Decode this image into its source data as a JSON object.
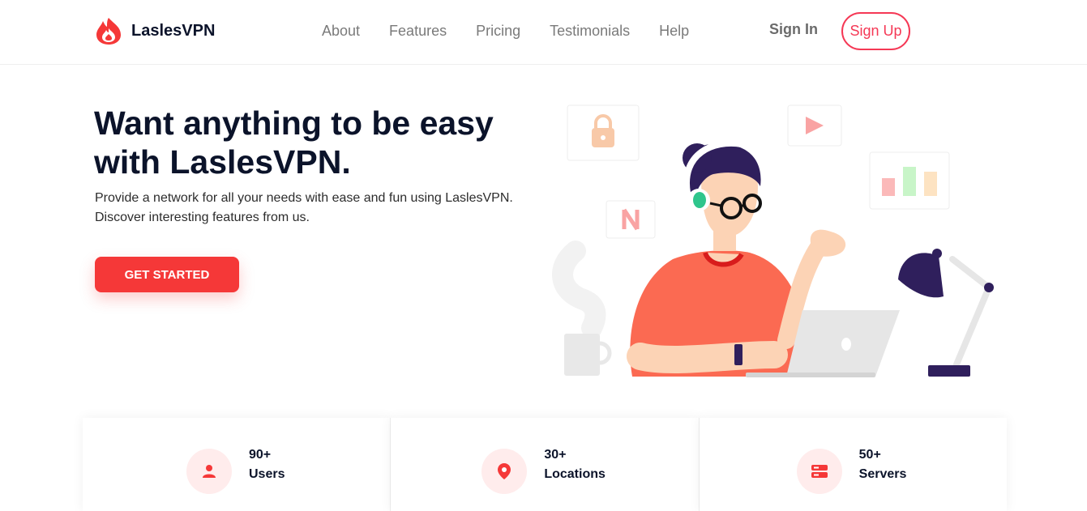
{
  "brand": {
    "name": "LaslesVPN",
    "accent": "#f53838"
  },
  "nav": {
    "items": [
      {
        "label": "About"
      },
      {
        "label": "Features"
      },
      {
        "label": "Pricing"
      },
      {
        "label": "Testimonials"
      },
      {
        "label": "Help"
      }
    ],
    "sign_in": "Sign In",
    "sign_up": "Sign Up"
  },
  "hero": {
    "title_line1": "Want anything to be easy",
    "title_line2": "with LaslesVPN.",
    "desc_line1": "Provide a network for all your needs with ease and fun using LaslesVPN.",
    "desc_line2": "Discover interesting features from us.",
    "cta": "GET STARTED"
  },
  "stats": [
    {
      "value": "90+",
      "label": "Users",
      "icon": "user-icon"
    },
    {
      "value": "30+",
      "label": "Locations",
      "icon": "location-pin-icon"
    },
    {
      "value": "50+",
      "label": "Servers",
      "icon": "server-icon"
    }
  ]
}
